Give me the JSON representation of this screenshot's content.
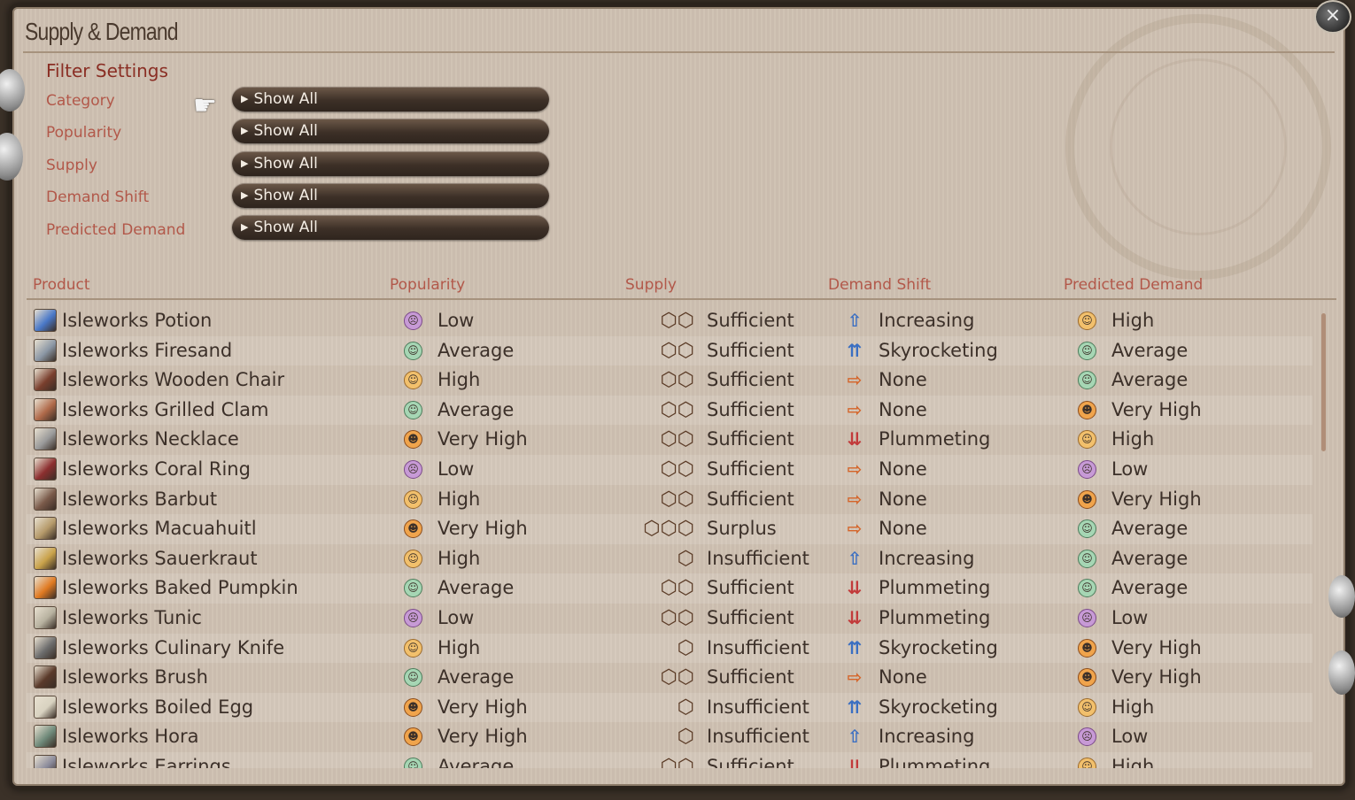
{
  "window": {
    "title": "Supply & Demand",
    "close_icon": "×"
  },
  "filters": {
    "heading": "Filter Settings",
    "items": [
      {
        "label": "Category",
        "value": "Show All"
      },
      {
        "label": "Popularity",
        "value": "Show All"
      },
      {
        "label": "Supply",
        "value": "Show All"
      },
      {
        "label": "Demand Shift",
        "value": "Show All"
      },
      {
        "label": "Predicted Demand",
        "value": "Show All"
      }
    ]
  },
  "columns": {
    "product": "Product",
    "popularity": "Popularity",
    "supply": "Supply",
    "demand_shift": "Demand Shift",
    "predicted_demand": "Predicted Demand"
  },
  "rows": [
    {
      "product": "Isleworks Potion",
      "icon": "potion-icon",
      "icon_color": "#4a78c8",
      "popularity": "Low",
      "supply": "Sufficient",
      "demand_shift": "Increasing",
      "predicted_demand": "High"
    },
    {
      "product": "Isleworks Firesand",
      "icon": "firesand-icon",
      "icon_color": "#8b97a5",
      "popularity": "Average",
      "supply": "Sufficient",
      "demand_shift": "Skyrocketing",
      "predicted_demand": "Average"
    },
    {
      "product": "Isleworks Wooden Chair",
      "icon": "chair-icon",
      "icon_color": "#7a3f2e",
      "popularity": "High",
      "supply": "Sufficient",
      "demand_shift": "None",
      "predicted_demand": "Average"
    },
    {
      "product": "Isleworks Grilled Clam",
      "icon": "clam-icon",
      "icon_color": "#b06a4a",
      "popularity": "Average",
      "supply": "Sufficient",
      "demand_shift": "None",
      "predicted_demand": "Very High"
    },
    {
      "product": "Isleworks Necklace",
      "icon": "necklace-icon",
      "icon_color": "#9a9a9a",
      "popularity": "Very High",
      "supply": "Sufficient",
      "demand_shift": "Plummeting",
      "predicted_demand": "High"
    },
    {
      "product": "Isleworks Coral Ring",
      "icon": "ring-icon",
      "icon_color": "#8c2f2f",
      "popularity": "Low",
      "supply": "Sufficient",
      "demand_shift": "None",
      "predicted_demand": "Low"
    },
    {
      "product": "Isleworks Barbut",
      "icon": "helmet-icon",
      "icon_color": "#7a5a4a",
      "popularity": "High",
      "supply": "Sufficient",
      "demand_shift": "None",
      "predicted_demand": "Very High"
    },
    {
      "product": "Isleworks Macuahuitl",
      "icon": "sword-icon",
      "icon_color": "#b59a6a",
      "popularity": "Very High",
      "supply": "Surplus",
      "demand_shift": "None",
      "predicted_demand": "Average"
    },
    {
      "product": "Isleworks Sauerkraut",
      "icon": "sauerkraut-icon",
      "icon_color": "#c9a24a",
      "popularity": "High",
      "supply": "Insufficient",
      "demand_shift": "Increasing",
      "predicted_demand": "Average"
    },
    {
      "product": "Isleworks Baked Pumpkin",
      "icon": "pumpkin-icon",
      "icon_color": "#e07a22",
      "popularity": "Average",
      "supply": "Sufficient",
      "demand_shift": "Plummeting",
      "predicted_demand": "Average"
    },
    {
      "product": "Isleworks Tunic",
      "icon": "tunic-icon",
      "icon_color": "#b8b2a0",
      "popularity": "Low",
      "supply": "Sufficient",
      "demand_shift": "Plummeting",
      "predicted_demand": "Low"
    },
    {
      "product": "Isleworks Culinary Knife",
      "icon": "knife-icon",
      "icon_color": "#6d6d6d",
      "popularity": "High",
      "supply": "Insufficient",
      "demand_shift": "Skyrocketing",
      "predicted_demand": "Very High"
    },
    {
      "product": "Isleworks Brush",
      "icon": "brush-icon",
      "icon_color": "#5a3a2a",
      "popularity": "Average",
      "supply": "Sufficient",
      "demand_shift": "None",
      "predicted_demand": "Very High"
    },
    {
      "product": "Isleworks Boiled Egg",
      "icon": "egg-icon",
      "icon_color": "#d8d2c0",
      "popularity": "Very High",
      "supply": "Insufficient",
      "demand_shift": "Skyrocketing",
      "predicted_demand": "High"
    },
    {
      "product": "Isleworks Hora",
      "icon": "hora-icon",
      "icon_color": "#6f8a7a",
      "popularity": "Very High",
      "supply": "Insufficient",
      "demand_shift": "Increasing",
      "predicted_demand": "Low"
    },
    {
      "product": "Isleworks Earrings",
      "icon": "earrings-icon",
      "icon_color": "#8a8a9a",
      "popularity": "Average",
      "supply": "Sufficient",
      "demand_shift": "Plummeting",
      "predicted_demand": "High"
    }
  ]
}
